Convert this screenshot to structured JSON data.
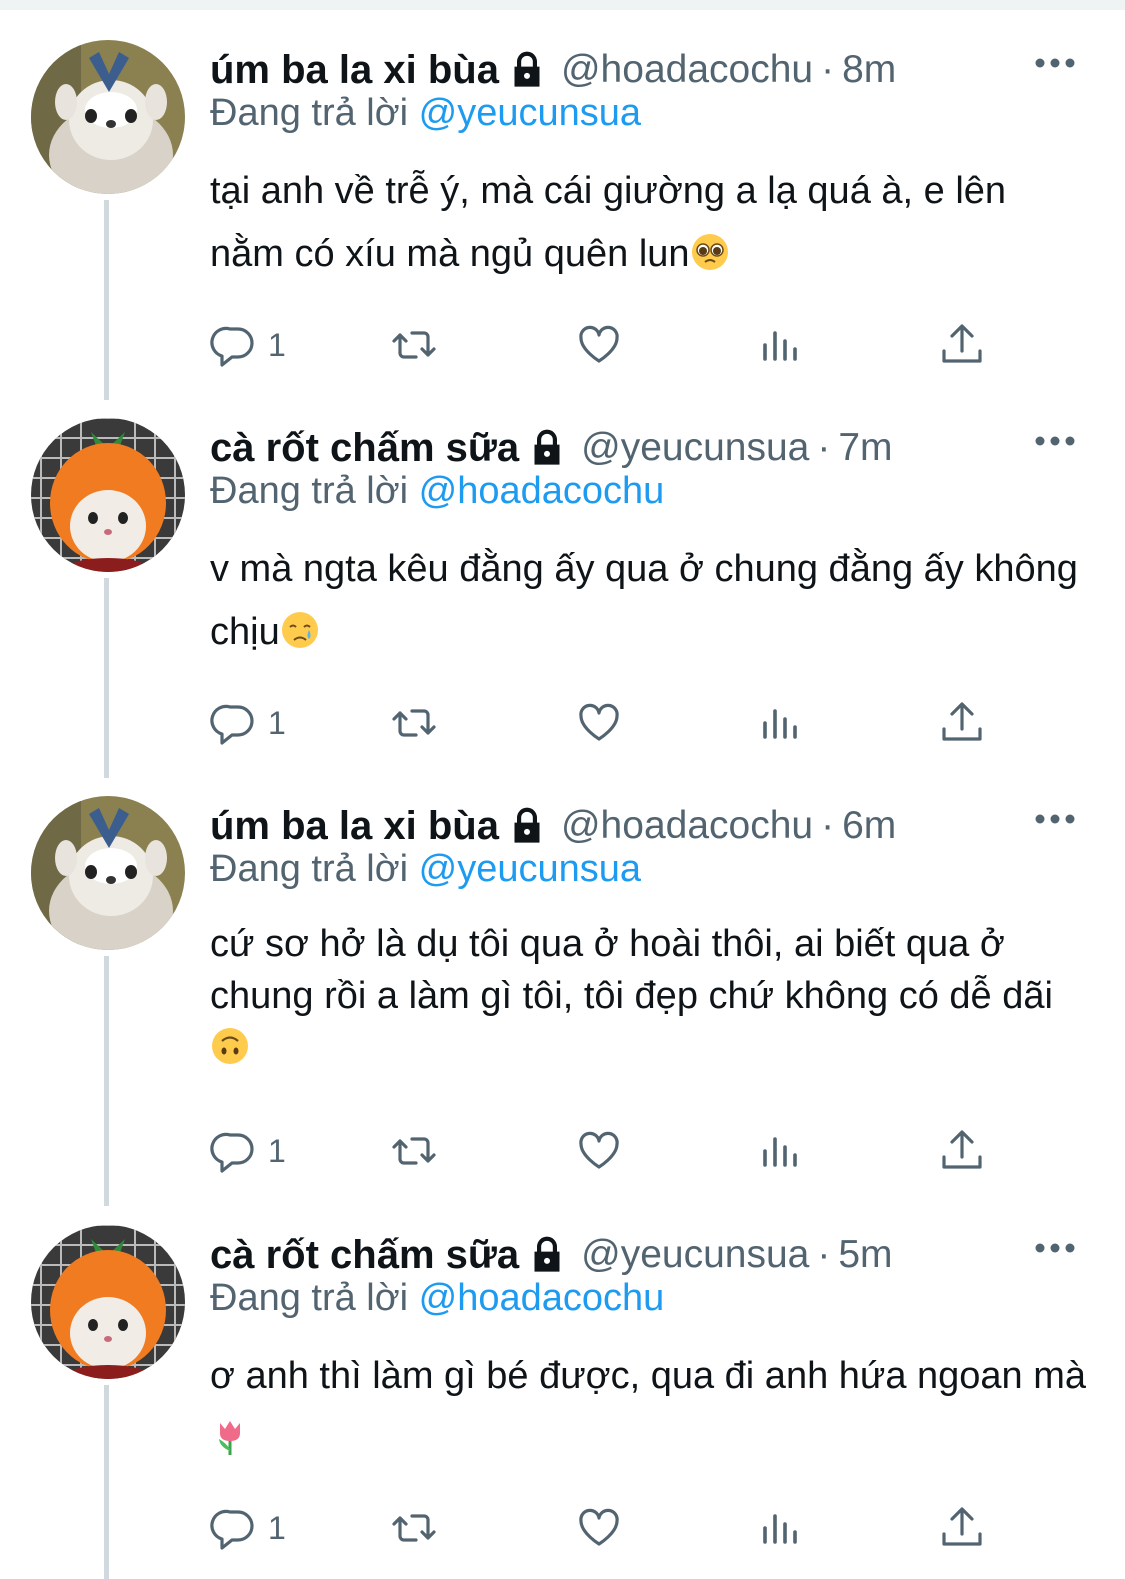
{
  "colors": {
    "accent": "#1d9bf0",
    "secondary_text": "#536471",
    "thread_line": "#cfd9de"
  },
  "reply_prefix": "Đang trả lời",
  "tweets": [
    {
      "name": "úm ba la xi bùa",
      "handle": "@hoadacochu",
      "time": "8m",
      "replying_to": "@yeucunsua",
      "text": "tại anh về trễ ý, mà cái giường a lạ quá à, e lên nằm có xíu mà ngủ quên lun",
      "emoji": "pleading-face-emoji",
      "reply_count": "1",
      "avatar": "penguin-hamster-avatar"
    },
    {
      "name": "cà rốt chấm sữa",
      "handle": "@yeucunsua",
      "time": "7m",
      "replying_to": "@hoadacochu",
      "text": "v mà ngta kêu đằng ấy qua ở chung đằng ấy không chịu",
      "emoji": "crying-face-emoji",
      "reply_count": "1",
      "avatar": "carrot-hamster-avatar"
    },
    {
      "name": "úm ba la xi bùa",
      "handle": "@hoadacochu",
      "time": "6m",
      "replying_to": "@yeucunsua",
      "text": "cứ sơ hở là dụ tôi qua ở hoài thôi, ai biết qua ở chung rồi a làm gì tôi, tôi đẹp chứ không có dễ dãi",
      "emoji": "upside-down-face-emoji",
      "reply_count": "1",
      "avatar": "penguin-hamster-avatar"
    },
    {
      "name": "cà rốt chấm sữa",
      "handle": "@yeucunsua",
      "time": "5m",
      "replying_to": "@hoadacochu",
      "text": "ơ anh thì làm gì bé được, qua đi anh hứa ngoan mà",
      "emoji": "tulip-emoji",
      "reply_count": "1",
      "avatar": "carrot-hamster-avatar"
    }
  ]
}
